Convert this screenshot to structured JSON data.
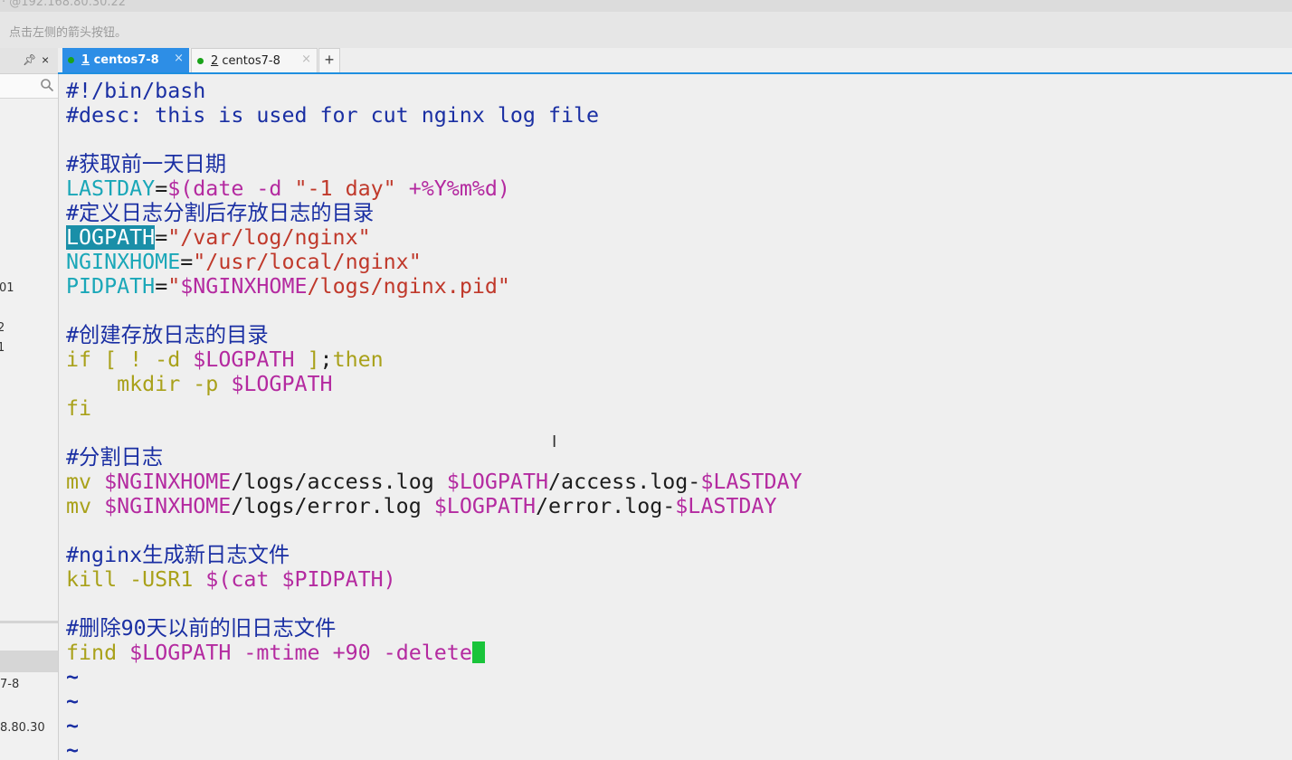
{
  "window": {
    "title_fragment": "· @192.168.80.30.22",
    "hint": "点击左侧的箭头按钮。"
  },
  "sidebar": {
    "pin_icon": "pin-icon",
    "close_label": "×",
    "fragments": [
      "01",
      "2",
      "1",
      "7-8",
      "8.80.30"
    ]
  },
  "tabs": [
    {
      "number": "1",
      "label": " centos7-8",
      "active": true,
      "status_color": "#1aa31a",
      "close_label": "×"
    },
    {
      "number": "2",
      "label": " centos7-8",
      "active": false,
      "status_color": "#1aa31a",
      "close_label": "×"
    }
  ],
  "tab_add_label": "+",
  "terminal": {
    "lines": [
      [
        {
          "t": "#!/bin/bash",
          "c": "cm"
        }
      ],
      [
        {
          "t": "#desc: this is used for cut nginx log file",
          "c": "cm"
        }
      ],
      [],
      [
        {
          "t": "#获取前一天日期",
          "c": "cm"
        }
      ],
      [
        {
          "t": "LASTDAY",
          "c": "var"
        },
        {
          "t": "=",
          "c": ""
        },
        {
          "t": "$(date -d ",
          "c": "mag"
        },
        {
          "t": "\"-1 day\"",
          "c": "str"
        },
        {
          "t": " +%Y%m%d)",
          "c": "mag"
        }
      ],
      [
        {
          "t": "#定义日志分割后存放日志的目录",
          "c": "cm"
        }
      ],
      [
        {
          "t": "LOGPATH",
          "c": "sel"
        },
        {
          "t": "=",
          "c": ""
        },
        {
          "t": "\"/var/log/nginx\"",
          "c": "str"
        }
      ],
      [
        {
          "t": "NGINXHOME",
          "c": "var"
        },
        {
          "t": "=",
          "c": ""
        },
        {
          "t": "\"/usr/local/nginx\"",
          "c": "str"
        }
      ],
      [
        {
          "t": "PIDPATH",
          "c": "var"
        },
        {
          "t": "=",
          "c": ""
        },
        {
          "t": "\"",
          "c": "str"
        },
        {
          "t": "$NGINXHOME",
          "c": "mag"
        },
        {
          "t": "/logs/nginx.pid\"",
          "c": "str"
        }
      ],
      [],
      [
        {
          "t": "#创建存放日志的目录",
          "c": "cm"
        }
      ],
      [
        {
          "t": "if [ ! -d ",
          "c": "kw"
        },
        {
          "t": "$LOGPATH",
          "c": "mag"
        },
        {
          "t": " ]",
          "c": "kw"
        },
        {
          "t": ";",
          "c": ""
        },
        {
          "t": "then",
          "c": "kw"
        }
      ],
      [
        {
          "t": "    mkdir -p ",
          "c": "ol"
        },
        {
          "t": "$LOGPATH",
          "c": "mag"
        }
      ],
      [
        {
          "t": "fi",
          "c": "kw"
        }
      ],
      [],
      [
        {
          "t": "#分割日志",
          "c": "cm"
        }
      ],
      [
        {
          "t": "mv ",
          "c": "ol"
        },
        {
          "t": "$NGINXHOME",
          "c": "mag"
        },
        {
          "t": "/logs/access.log ",
          "c": ""
        },
        {
          "t": "$LOGPATH",
          "c": "mag"
        },
        {
          "t": "/access.log-",
          "c": ""
        },
        {
          "t": "$LASTDAY",
          "c": "mag"
        }
      ],
      [
        {
          "t": "mv ",
          "c": "ol"
        },
        {
          "t": "$NGINXHOME",
          "c": "mag"
        },
        {
          "t": "/logs/error.log ",
          "c": ""
        },
        {
          "t": "$LOGPATH",
          "c": "mag"
        },
        {
          "t": "/error.log-",
          "c": ""
        },
        {
          "t": "$LASTDAY",
          "c": "mag"
        }
      ],
      [],
      [
        {
          "t": "#nginx生成新日志文件",
          "c": "cm"
        }
      ],
      [
        {
          "t": "kill -USR1 ",
          "c": "ol"
        },
        {
          "t": "$(cat ",
          "c": "mag"
        },
        {
          "t": "$PIDPATH",
          "c": "mag"
        },
        {
          "t": ")",
          "c": "mag"
        }
      ],
      [],
      [
        {
          "t": "#删除90天以前的旧日志文件",
          "c": "cm"
        }
      ],
      [
        {
          "t": "find ",
          "c": "ol"
        },
        {
          "t": "$LOGPATH",
          "c": "mag"
        },
        {
          "t": " -mtime +90 -delete",
          "c": "mag"
        },
        {
          "t": "",
          "c": "cursor"
        }
      ],
      [
        {
          "t": "~",
          "c": "tilde"
        }
      ],
      [
        {
          "t": "~",
          "c": "tilde"
        }
      ],
      [
        {
          "t": "~",
          "c": "tilde"
        }
      ],
      [
        {
          "t": "~",
          "c": "tilde"
        }
      ]
    ]
  }
}
